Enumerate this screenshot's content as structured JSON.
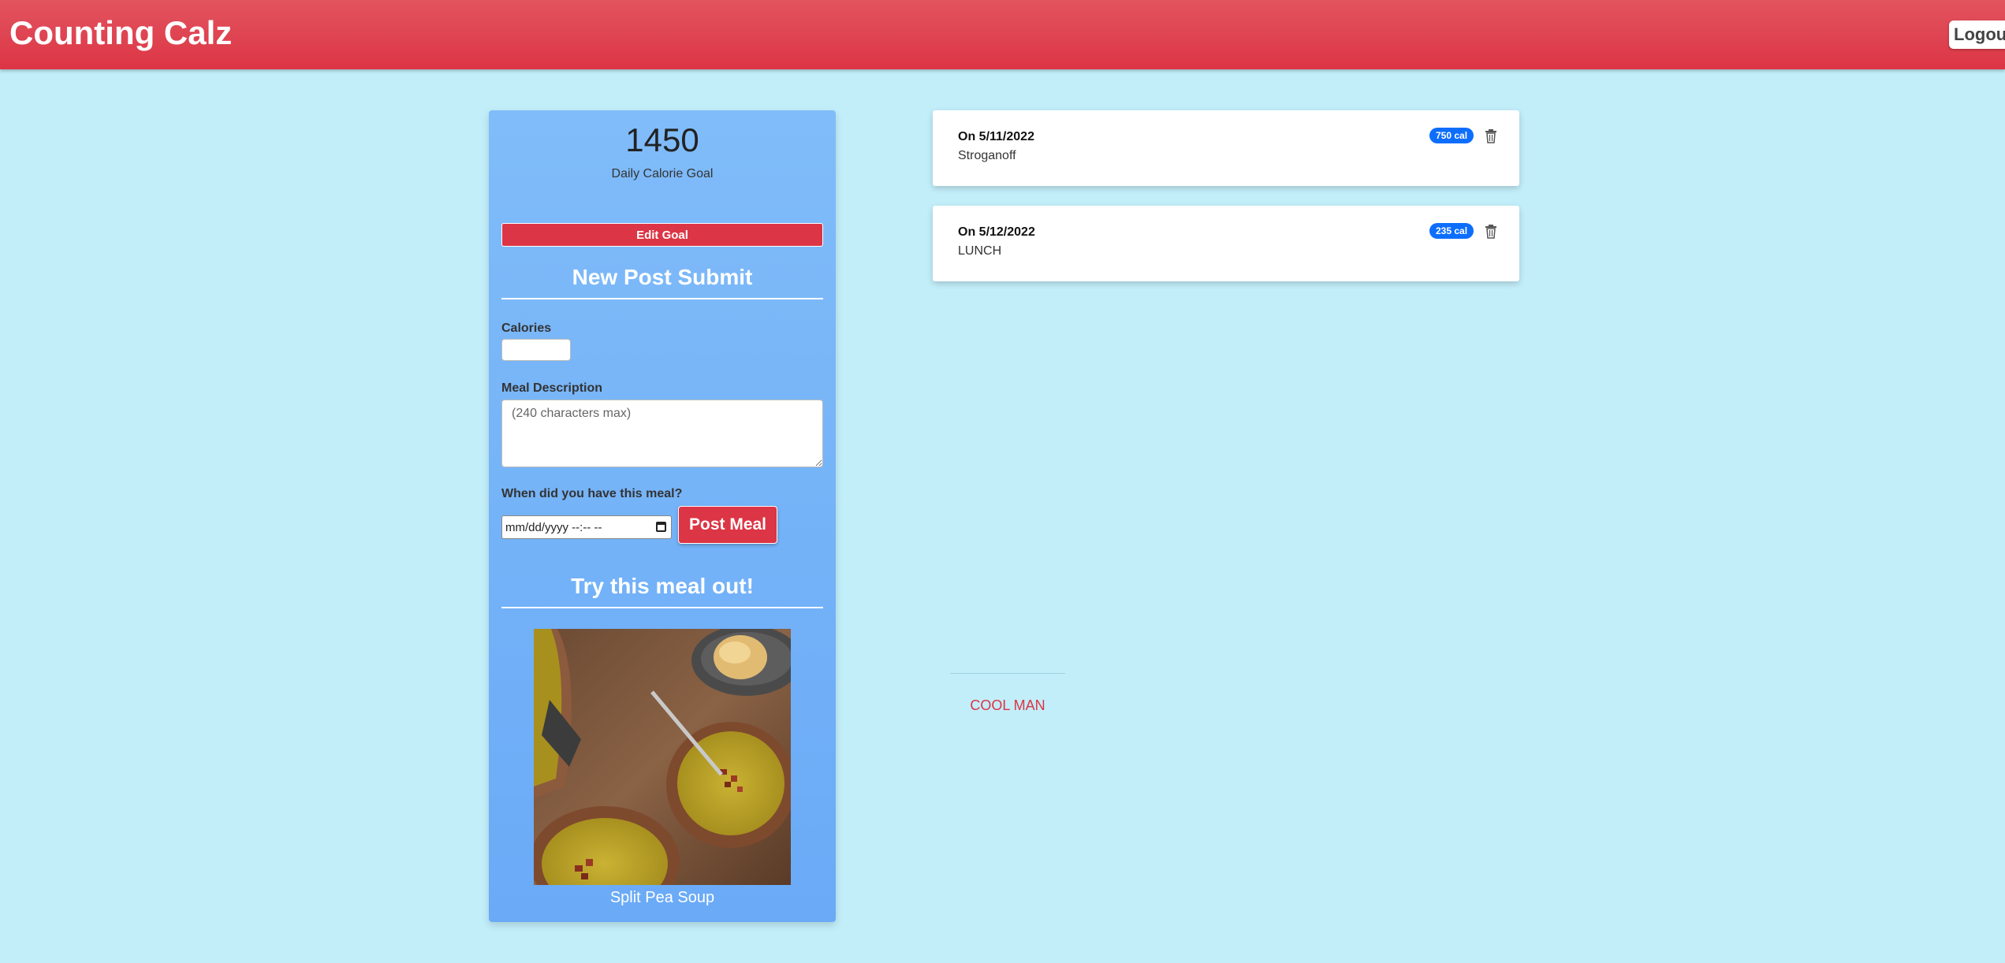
{
  "app": {
    "title": "Counting Calz",
    "logout_label": "Logout"
  },
  "goal": {
    "value": "1450",
    "label": "Daily Calorie Goal",
    "edit_label": "Edit Goal"
  },
  "form": {
    "title": "New Post Submit",
    "calories_label": "Calories",
    "calories_value": "",
    "description_label": "Meal Description",
    "description_placeholder": "(240 characters max)",
    "when_label": "When did you have this meal?",
    "datetime_placeholder": "mm/dd/yyyy --:-- --",
    "submit_label": "Post Meal"
  },
  "suggestion": {
    "title": "Try this meal out!",
    "meal_name": "Split Pea Soup",
    "image_icon": "soup-photo"
  },
  "meals": [
    {
      "date": "On 5/11/2022",
      "description": "Stroganoff",
      "calories": "750 cal"
    },
    {
      "date": "On 5/12/2022",
      "description": "LUNCH",
      "calories": "235 cal"
    }
  ],
  "footer": {
    "text": "COOL MAN"
  },
  "colors": {
    "brand": "#dc3545",
    "background": "#c2eefa",
    "panel": "#74b4f8",
    "badge": "#0d6efd"
  }
}
